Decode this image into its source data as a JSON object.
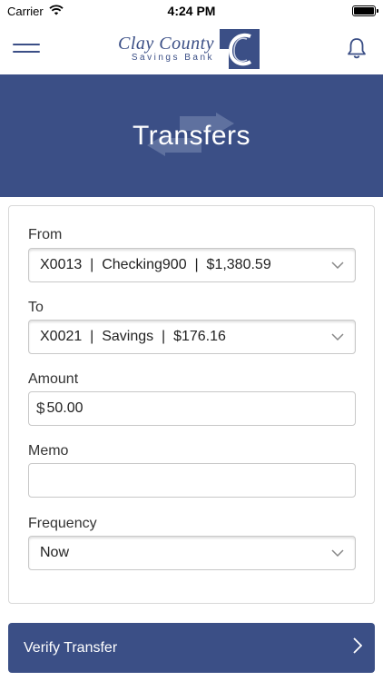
{
  "status_bar": {
    "carrier": "Carrier",
    "time": "4:24 PM",
    "battery_level": 1.0
  },
  "header": {
    "logo_name": "Clay County",
    "logo_subtitle": "Savings Bank",
    "menu_icon": "hamburger-icon",
    "notification_icon": "bell-icon"
  },
  "banner": {
    "title": "Transfers",
    "icon": "transfer-arrows-icon"
  },
  "form": {
    "from_label": "From",
    "from_value": "X0013  |  Checking900  |  $1,380.59",
    "to_label": "To",
    "to_value": "X0021  |  Savings  |  $176.16",
    "amount_label": "Amount",
    "amount_currency": "$",
    "amount_value": "50.00",
    "memo_label": "Memo",
    "memo_value": "",
    "frequency_label": "Frequency",
    "frequency_value": "Now"
  },
  "actions": {
    "verify_label": "Verify Transfer"
  },
  "colors": {
    "brand": "#3b4f86",
    "border": "#c8c8c8"
  }
}
